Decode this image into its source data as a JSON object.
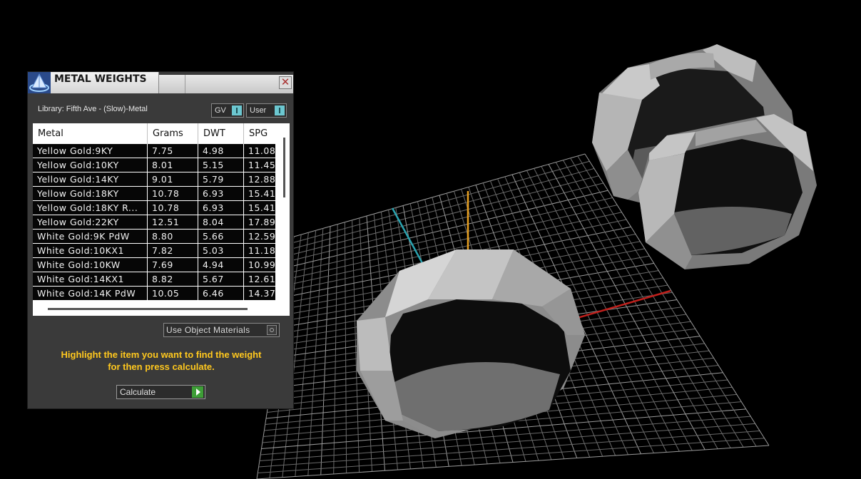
{
  "window": {
    "title": "METAL WEIGHTS",
    "close_glyph": "✕"
  },
  "library": {
    "label": "Library: Fifth Ave - (Slow)-Metal",
    "gv_label": "GV",
    "user_label": "User"
  },
  "table": {
    "columns": [
      "Metal",
      "Grams",
      "DWT",
      "SPG"
    ],
    "rows": [
      [
        "Yellow Gold:9KY",
        "7.75",
        "4.98",
        "11.08"
      ],
      [
        "Yellow Gold:10KY",
        "8.01",
        "5.15",
        "11.45"
      ],
      [
        "Yellow Gold:14KY",
        "9.01",
        "5.79",
        "12.88"
      ],
      [
        "Yellow Gold:18KY",
        "10.78",
        "6.93",
        "15.41"
      ],
      [
        "Yellow Gold:18KY R...",
        "10.78",
        "6.93",
        "15.41"
      ],
      [
        "Yellow Gold:22KY",
        "12.51",
        "8.04",
        "17.89"
      ],
      [
        "White Gold:9K PdW",
        "8.80",
        "5.66",
        "12.59"
      ],
      [
        "White Gold:10KX1",
        "7.82",
        "5.03",
        "11.18"
      ],
      [
        "White Gold:10KW",
        "7.69",
        "4.94",
        "10.99"
      ],
      [
        "White Gold:14KX1",
        "8.82",
        "5.67",
        "12.61"
      ],
      [
        "White Gold:14K PdW",
        "10.05",
        "6.46",
        "14.37"
      ]
    ]
  },
  "use_object_materials": {
    "label": "Use Object Materials"
  },
  "instructions": {
    "line1": "Highlight the item you want to find the weight",
    "line2": "for then press calculate."
  },
  "calculate_button": {
    "label": "Calculate"
  },
  "icons": {
    "app_logo": "pyramid-logo-icon",
    "close": "close-icon",
    "toggle": "toggle-icon",
    "radio": "radio-icon",
    "play": "play-icon"
  },
  "colors": {
    "panel_bg": "#3a3a3a",
    "instruction_text": "#ffc81e",
    "toggle_accent": "#6cc7d0",
    "play_green": "#3e9e37",
    "axis_x": "#c0201c",
    "axis_y": "#e8a020",
    "axis_z": "#2aa3b0"
  }
}
